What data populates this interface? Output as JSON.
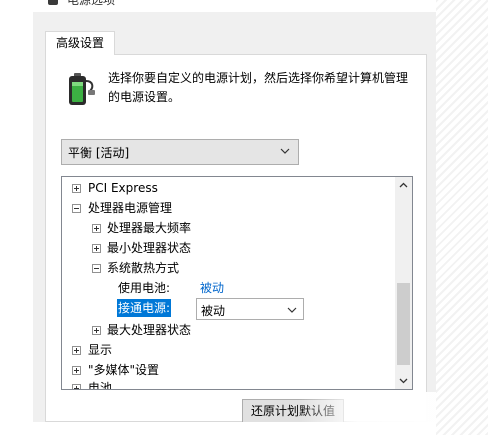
{
  "window": {
    "title": "电源选项"
  },
  "tabs": [
    {
      "label": "高级设置"
    }
  ],
  "description": "选择你要自定义的电源计划，然后选择你希望计算机管理的电源设置。",
  "plan_select": {
    "value": "平衡 [活动]"
  },
  "tree": {
    "items": [
      {
        "label": "PCI Express"
      },
      {
        "label": "处理器电源管理"
      },
      {
        "label": "处理器最大频率"
      },
      {
        "label": "最小处理器状态"
      },
      {
        "label": "系统散热方式"
      },
      {
        "label": "使用电池:",
        "value": "被动"
      },
      {
        "label": "接通电源:",
        "value": "被动"
      },
      {
        "label": "最大处理器状态"
      },
      {
        "label": "显示"
      },
      {
        "label": "\"多媒体\"设置"
      },
      {
        "label": "电池"
      }
    ]
  },
  "buttons": {
    "restore_label": "还原计划默认值"
  },
  "colors": {
    "selection": "#0078d7",
    "link": "#0066cc",
    "battery_green": "#3cb043"
  }
}
